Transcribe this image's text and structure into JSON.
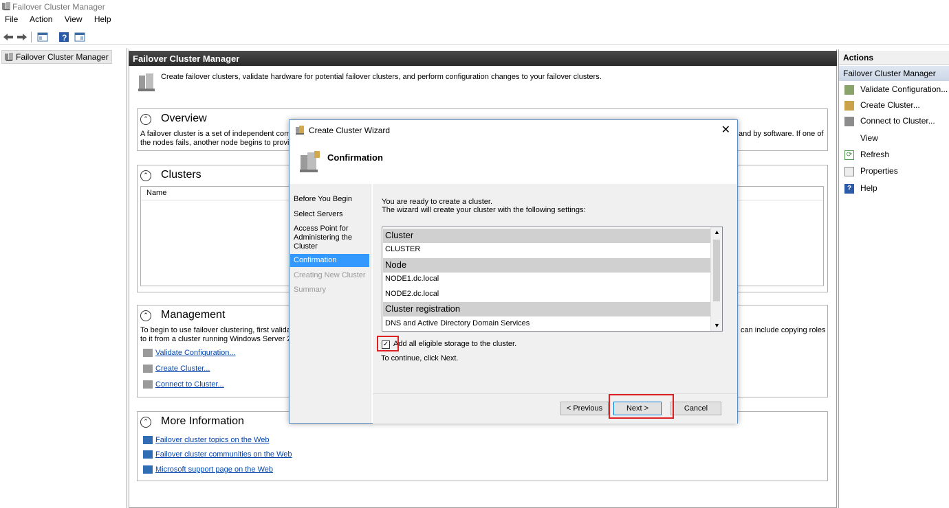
{
  "window": {
    "title": "Failover Cluster Manager"
  },
  "menu": [
    "File",
    "Action",
    "View",
    "Help"
  ],
  "tree": {
    "root": "Failover Cluster Manager"
  },
  "main": {
    "header": "Failover Cluster Manager",
    "description": "Create failover clusters, validate hardware for potential failover clusters, and perform configuration changes to your failover clusters.",
    "overview": {
      "title": "Overview",
      "text1": "A failover cluster is a set of independent comp",
      "text1_right": "and by software. If one of",
      "text2": "the nodes fails, another node begins to provid"
    },
    "clusters": {
      "title": "Clusters",
      "col_name": "Name"
    },
    "management": {
      "title": "Management",
      "text1": "To begin to use failover clustering, first validat",
      "text1_right": "can include copying roles",
      "text2": "to it from a cluster running Windows Server 20",
      "links": [
        "Validate Configuration...",
        "Create Cluster...",
        "Connect to Cluster..."
      ]
    },
    "more_info": {
      "title": "More Information",
      "links": [
        "Failover cluster topics on the Web",
        "Failover cluster communities on the Web",
        "Microsoft support page on the Web"
      ]
    }
  },
  "actions": {
    "title": "Actions",
    "subheader": "Failover Cluster Manager",
    "items": [
      "Validate Configuration...",
      "Create Cluster...",
      "Connect to Cluster...",
      "View",
      "Refresh",
      "Properties",
      "Help"
    ]
  },
  "wizard": {
    "title": "Create Cluster Wizard",
    "close": "✕",
    "heading": "Confirmation",
    "steps": [
      "Before You Begin",
      "Select Servers",
      "Access Point for Administering the Cluster",
      "Confirmation",
      "Creating New Cluster",
      "Summary"
    ],
    "intro1": "You are ready to create a cluster.",
    "intro2": "The wizard will create your cluster with the following settings:",
    "settings": {
      "cluster_head": "Cluster",
      "cluster_value": "CLUSTER",
      "node_head": "Node",
      "node1": "NODE1.dc.local",
      "node2": "NODE2.dc.local",
      "reg_head": "Cluster registration",
      "reg_value": "DNS and Active Directory Domain Services"
    },
    "checkbox_label": "Add all eligible storage to the cluster.",
    "checkbox_checked": true,
    "continue_text": "To continue, click Next.",
    "buttons": {
      "previous": "< Previous",
      "next": "Next >",
      "cancel": "Cancel"
    }
  },
  "colors": {
    "accent": "#3399ff",
    "highlight": "#e02020",
    "link": "#0645ad"
  }
}
